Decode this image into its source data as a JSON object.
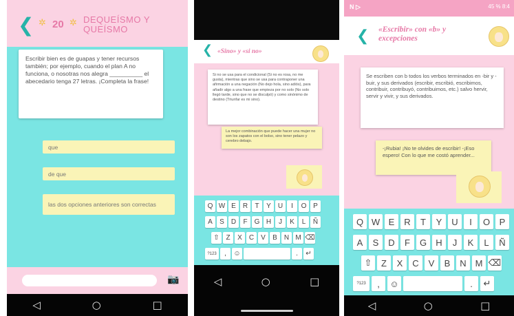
{
  "screen1": {
    "back": "❮",
    "score": "20",
    "title": "DEQUEÍSMO Y QUEÍSMO",
    "question": "Escribir bien es de guapas y tener recursos también; por ejemplo, cuando el plan A no funciona, o nosotras nos alegra __________ el abecedario tenga 27 letras. ¡Completa la frase!",
    "options": [
      "que",
      "de que",
      "las dos opciones anteriores son correctas"
    ]
  },
  "screen2": {
    "back": "❮",
    "title": "«Sino» y «si no»",
    "bubble1": "Si no se usa para el condicional (Si no es rosa, no me gusta), mientras que sino se usa para contraponer una afirmación a una negación (No dejo hola, sino adiós), para añadir algo a una frase que empieza por no solo (No solo llegó tarde, sino que no se disculpó) y como sinónimo de destino (Triunfar es mi sino).",
    "bubble2": "La mejor combinación que puede hacer una mujer no son los zapatos con el bolso, sino tener pelazo y cerebro debajo.",
    "keyboard": [
      [
        "Q",
        "W",
        "E",
        "R",
        "T",
        "Y",
        "U",
        "I",
        "O",
        "P"
      ],
      [
        "A",
        "S",
        "D",
        "F",
        "G",
        "H",
        "J",
        "K",
        "L",
        "Ñ"
      ],
      [
        "⇧",
        "Z",
        "X",
        "C",
        "V",
        "B",
        "N",
        "M",
        "⌫"
      ],
      [
        "?123",
        ",",
        "☺",
        " ",
        ".",
        "↵"
      ]
    ]
  },
  "screen3": {
    "status_left": "N ▷",
    "status_right": "45 % 8:4",
    "back": "❮",
    "title": "«Escribir» con «b» y excepciones",
    "bubble1": "Se escriben con b todos los verbos terminados en -bir y -buir, y sus derivados (escribir, escribió, escribimos, contribuir, contribuyó, contribuimos, etc.) salvo hervir, servir y vivir, y sus derivados.",
    "bubble2": "-¡Rubia! ¡No te olvides de escribir! -¡Eso espero! Con lo que me costó aprender...",
    "keyboard": [
      [
        "Q",
        "W",
        "E",
        "R",
        "T",
        "Y",
        "U",
        "I",
        "O",
        "P"
      ],
      [
        "A",
        "S",
        "D",
        "F",
        "G",
        "H",
        "J",
        "K",
        "L",
        "Ñ"
      ],
      [
        "⇧",
        "Z",
        "X",
        "C",
        "V",
        "B",
        "N",
        "M",
        "⌫"
      ],
      [
        "?123",
        ",",
        "☺",
        " ",
        ".",
        "↵"
      ]
    ]
  },
  "nav": {
    "back": "◁",
    "home": "○",
    "recent": "□"
  },
  "colors": {
    "accent": "#26b3a8",
    "pink": "#fbd3e3",
    "title_pink": "#e678a6",
    "cyan": "#7ae5e3",
    "yellow": "#faf4b7"
  }
}
